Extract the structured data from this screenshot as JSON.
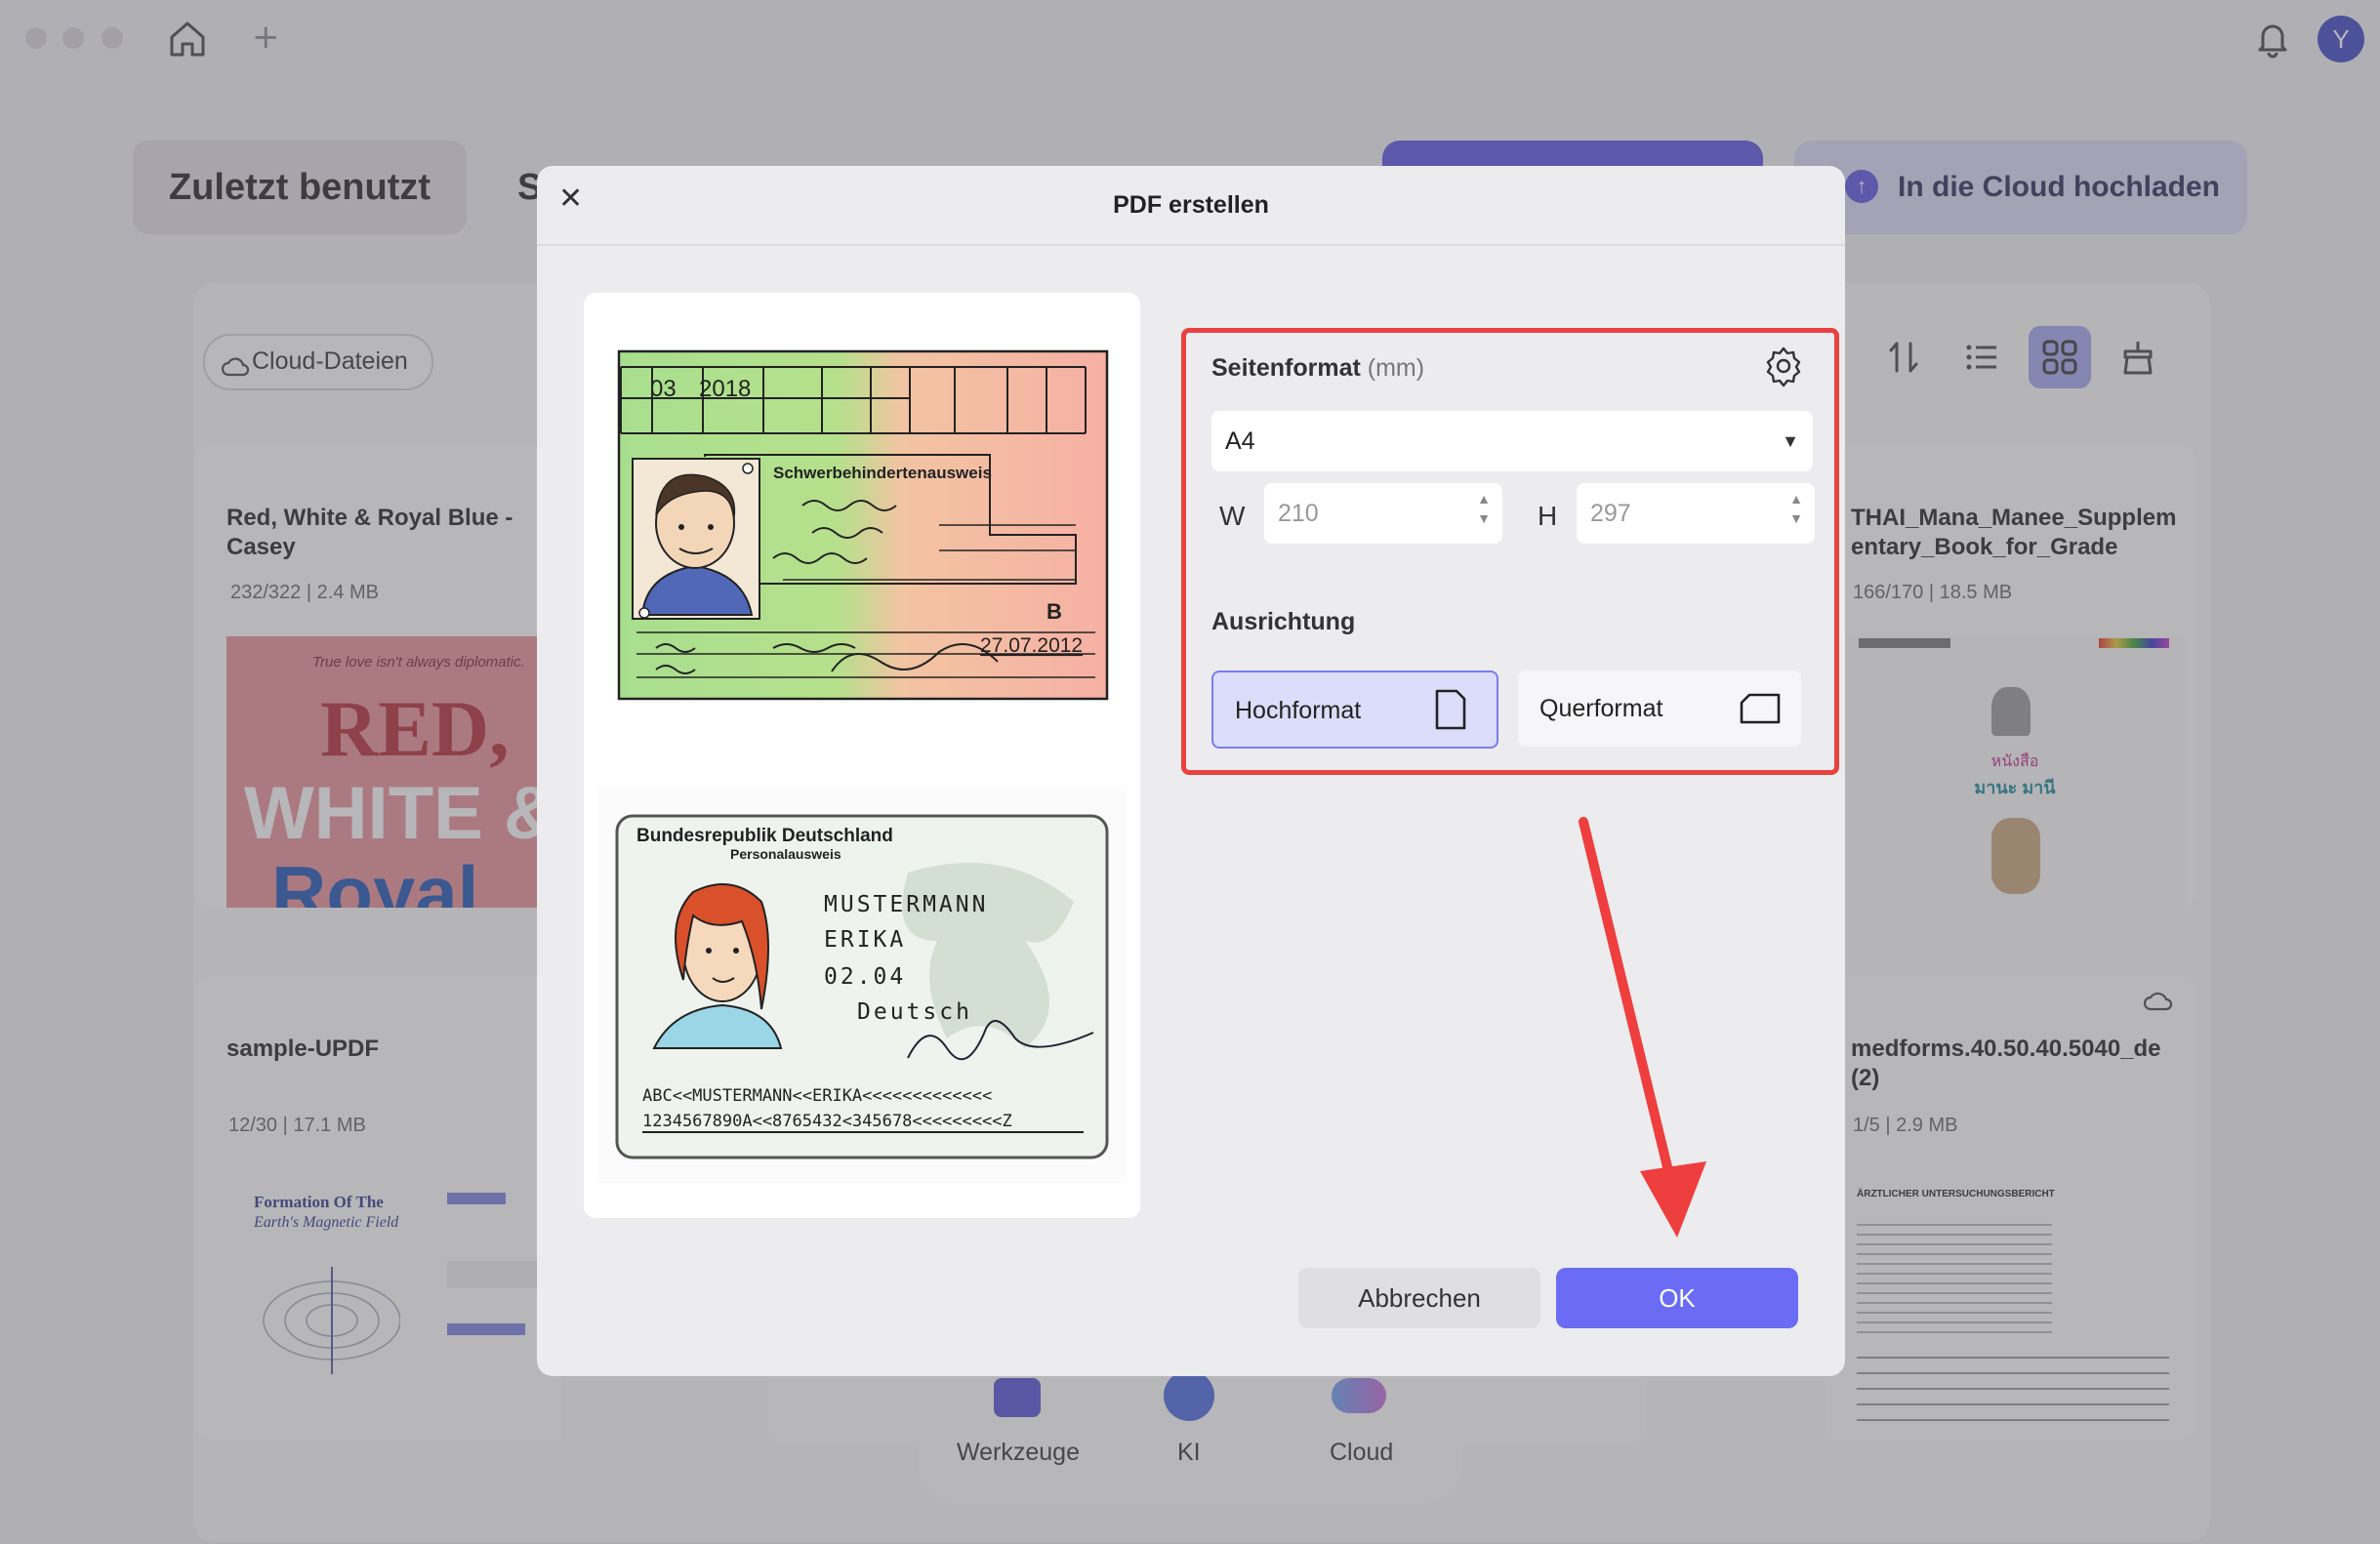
{
  "app": {
    "avatar_initial": "Y",
    "tabs": {
      "recent": "Zuletzt benutzt",
      "partial": "S"
    },
    "upload_button": "In die Cloud hochladen",
    "cloud_files_chip": "Cloud-Dateien",
    "files": [
      {
        "title": "Red, White & Royal Blue - Casey",
        "pages": "232/322",
        "size": "2.4 MB"
      },
      {
        "title": "THAI_Mana_Manee_Supplementary_Book_for_Grade",
        "pages": "166/170",
        "size": "18.5 MB"
      },
      {
        "title": "sample-UPDF",
        "pages": "12/30",
        "size": "17.1 MB"
      },
      {
        "title": "medforms.40.50.40.5040_de(2)",
        "pages": "1/5",
        "size": "2.9 MB"
      }
    ],
    "thumb_text": {
      "red_tagline": "True love isn't always diplomatic.",
      "red_line1": "RED,",
      "red_line2": "WHITE &",
      "red_line3": "Royal",
      "formation_title": "Formation Of The",
      "formation_sub": "Earth's Magnetic Field",
      "med_header": "ÄRZTLICHER UNTERSUCHUNGSBERICHT"
    },
    "dock": {
      "tools": "Werkzeuge",
      "ai": "KI",
      "cloud": "Cloud"
    }
  },
  "dialog": {
    "title": "PDF erstellen",
    "page_format_label": "Seitenformat",
    "page_format_unit": "(mm)",
    "page_format_value": "A4",
    "width_label": "W",
    "width_value": "210",
    "height_label": "H",
    "height_value": "297",
    "orientation_label": "Ausrichtung",
    "portrait": "Hochformat",
    "landscape": "Querformat",
    "selected_orientation": "Hochformat",
    "cancel": "Abbrechen",
    "ok": "OK"
  },
  "id_card1": {
    "date_top": "03",
    "year_top": "2018",
    "title": "Schwerbehindertenausweis",
    "mark": "B",
    "date": "27.07.2012"
  },
  "id_card2": {
    "country": "Bundesrepublik Deutschland",
    "doc": "Personalausweis",
    "surname": "MUSTERMANN",
    "given": "ERIKA",
    "dob": "02.04",
    "nationality": "Deutsch",
    "mrz1": "ABC<<MUSTERMANN<<ERIKA<<<<<<<<<<<<<",
    "mrz2": "1234567890A<<8765432<345678<<<<<<<<<Z"
  },
  "colors": {
    "accent": "#6a6cf5",
    "highlight_border": "#e8413f",
    "arrow": "#ee3e3e",
    "selected_bg": "#dcdcfb"
  }
}
